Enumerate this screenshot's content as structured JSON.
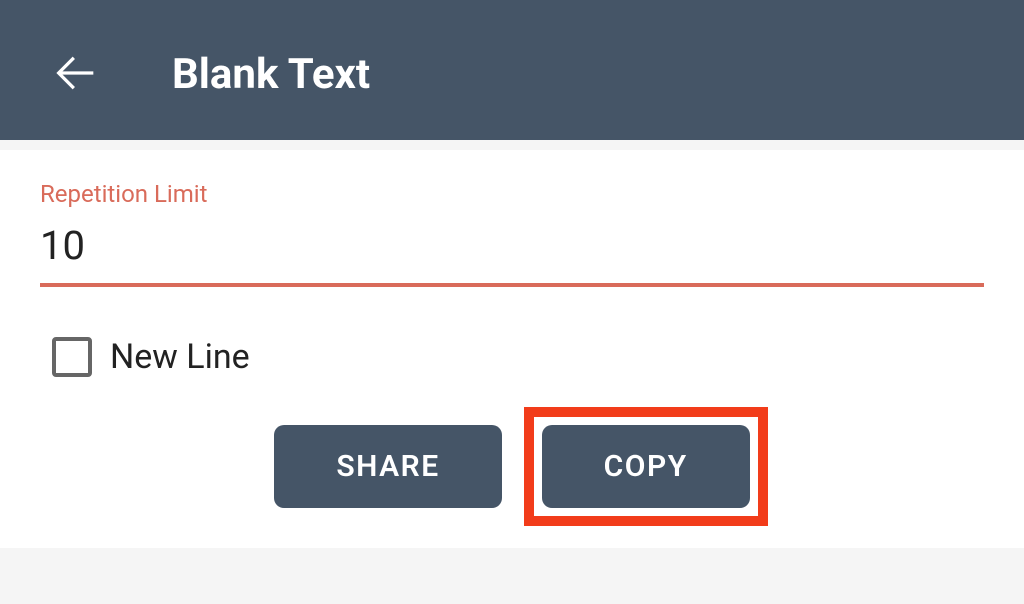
{
  "header": {
    "title": "Blank Text"
  },
  "form": {
    "repetition_label": "Repetition Limit",
    "repetition_value": "10",
    "newline_label": "New Line"
  },
  "buttons": {
    "share": "SHARE",
    "copy": "COPY"
  }
}
